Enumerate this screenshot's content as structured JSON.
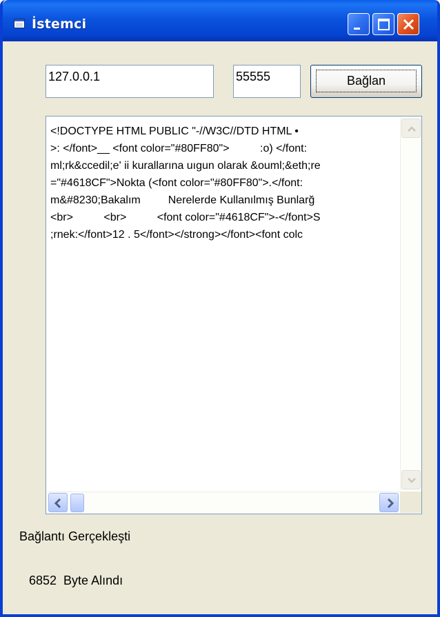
{
  "window": {
    "title": "İstemci",
    "icon": "app-window-icon",
    "controls": [
      "minimize-icon",
      "maximize-icon",
      "close-icon"
    ]
  },
  "connection": {
    "ip_value": "127.0.0.1",
    "port_value": "55555",
    "connect_label": "Bağlan"
  },
  "received": {
    "lines": [
      "<!DOCTYPE HTML PUBLIC \"-//W3C//DTD HTML •",
      ">: </font>__ <font color=\"#80FF80\">          :o) </font:",
      "ml;rk&ccedil;e' ii kurallarına uıgun olarak &ouml;&eth;re",
      "=\"#4618CF\">Nokta (<font color=\"#80FF80\">.</font:",
      "m&#8230;Bakalım         Nerelerde Kullanılmış Bunlarğ",
      "<br>          <br>          <font color=\"#4618CF\">-</font>S",
      ";rnek:</font>12 . 5</font></strong></font><font colc"
    ]
  },
  "status": {
    "connection_text": "Bağlantı Gerçekleşti",
    "bytes_text": "6852  Byte Alındı"
  },
  "colors": {
    "titlebar": "#0542d0",
    "window_face": "#ece9d8",
    "close_button": "#e2541f",
    "field_border": "#7f9db9"
  }
}
